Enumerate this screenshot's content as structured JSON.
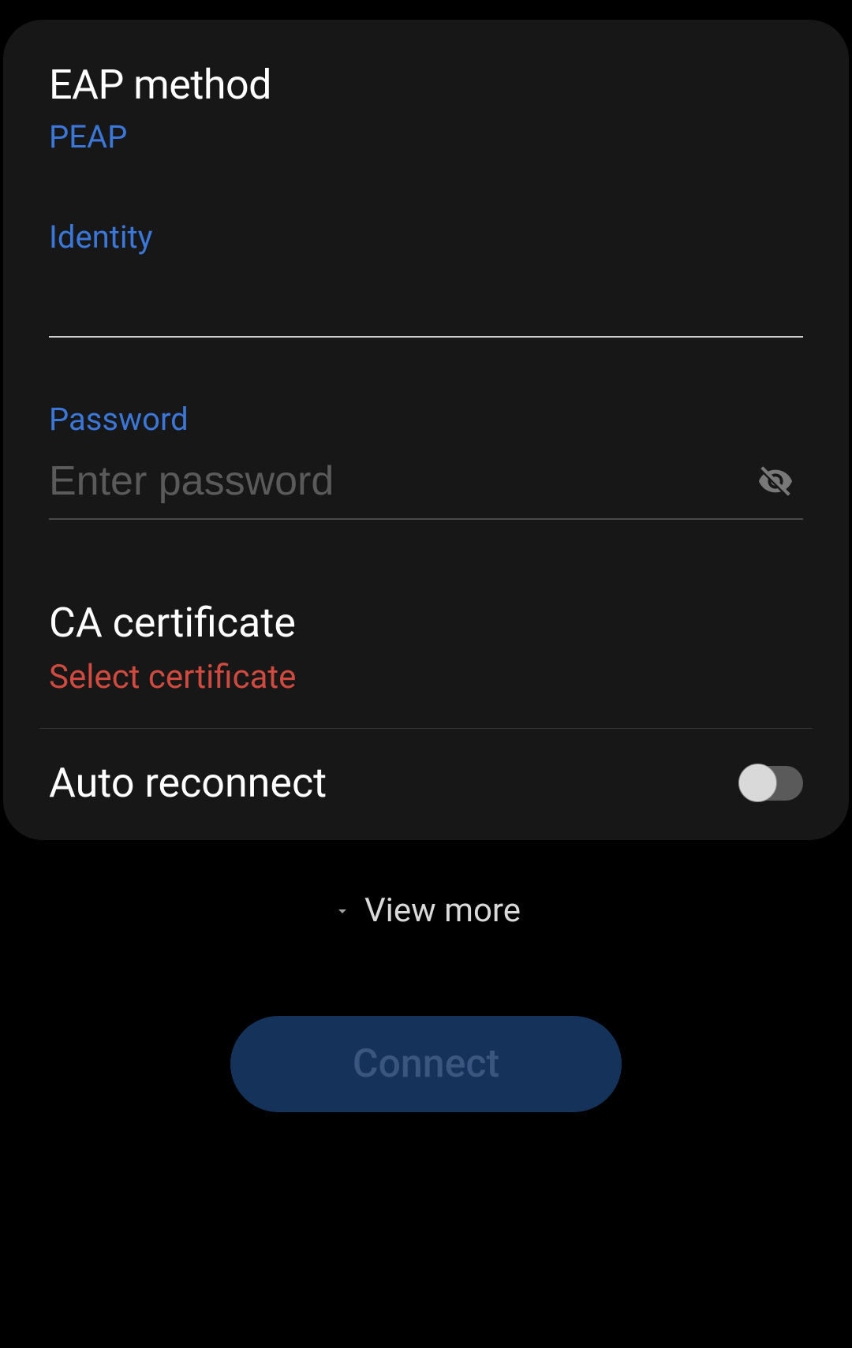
{
  "eap": {
    "title": "EAP method",
    "value": "PEAP"
  },
  "identity": {
    "label": "Identity",
    "value": ""
  },
  "password": {
    "label": "Password",
    "placeholder": "Enter password",
    "value": ""
  },
  "certificate": {
    "title": "CA certificate",
    "value": "Select certificate"
  },
  "autoReconnect": {
    "label": "Auto reconnect",
    "enabled": false
  },
  "viewMore": {
    "label": "View more"
  },
  "connect": {
    "label": "Connect"
  }
}
